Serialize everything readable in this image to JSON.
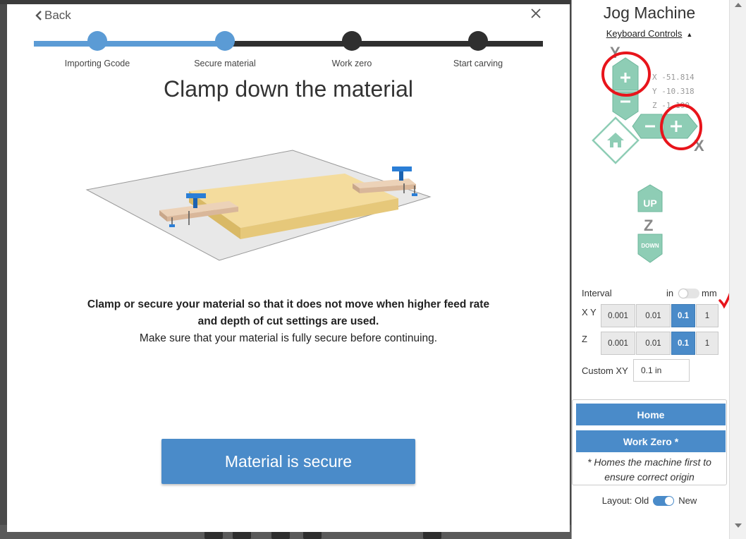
{
  "wizard": {
    "back_label": "Back",
    "steps": [
      {
        "label": "Importing Gcode",
        "state": "done"
      },
      {
        "label": "Secure material",
        "state": "current"
      },
      {
        "label": "Work zero",
        "state": "todo"
      },
      {
        "label": "Start carving",
        "state": "todo"
      }
    ],
    "title": "Clamp down the material",
    "description_bold_line1": "Clamp or secure your material so that it does not move when higher feed rate",
    "description_bold_line2": "and depth of cut settings are used.",
    "description_line3": "Make sure that your material is fully secure before continuing.",
    "primary_button": "Material is secure"
  },
  "jog": {
    "title": "Jog Machine",
    "keyboard_controls": "Keyboard Controls",
    "axis_labels": {
      "x": "X",
      "y": "Y",
      "z": "Z"
    },
    "coords": {
      "x": "X -51.814",
      "y": "Y -10.318",
      "z": "Z -1.190"
    },
    "up_label": "UP",
    "down_label": "DOWN",
    "interval_label": "Interval",
    "unit_in": "in",
    "unit_mm": "mm",
    "xy_label": "X Y",
    "z_label": "Z",
    "xy_options": [
      "0.001",
      "0.01",
      "0.1",
      "1"
    ],
    "xy_selected": "0.1",
    "z_options": [
      "0.001",
      "0.01",
      "0.1",
      "1"
    ],
    "z_selected": "0.1",
    "custom_xy_label": "Custom XY",
    "custom_xy_value": "0.1 in",
    "home_button": "Home",
    "work_zero_button": "Work Zero *",
    "home_note_line1": "* Homes the machine first to",
    "home_note_line2": "ensure correct origin",
    "layout_label": "Layout: Old",
    "layout_new": "New"
  },
  "colors": {
    "accent_blue": "#4a8bc9",
    "step_done": "#5b9bd5",
    "jog_green": "#8ecdb5",
    "annotation_red": "#e8141b"
  }
}
